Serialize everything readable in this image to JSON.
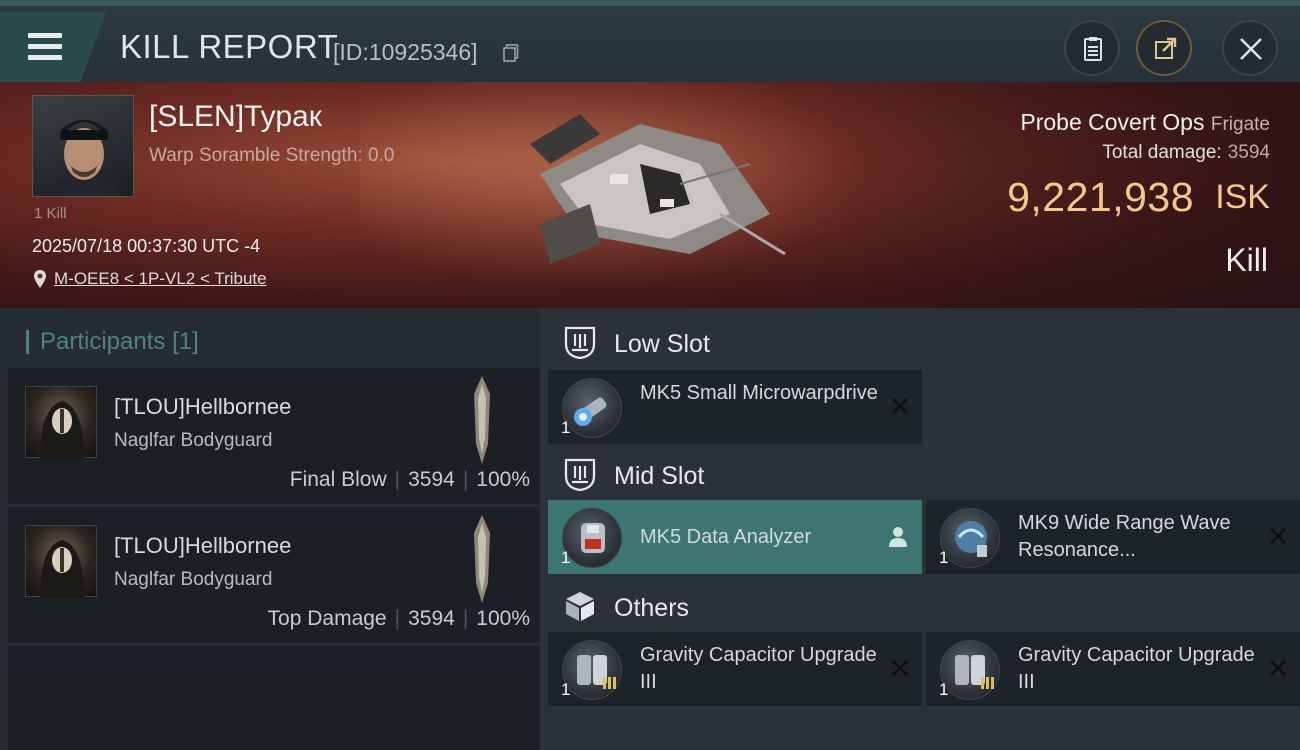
{
  "header": {
    "title": "KILL REPORT",
    "report_id": "[ID:10925346]"
  },
  "victim": {
    "name": "[SLEN]Турак",
    "warp_scramble": "Warp Soramble Strength: 0.0",
    "kills": "1 Kill",
    "datetime": "2025/07/18 00:37:30 UTC -4",
    "location": "M-OEE8 < 1P-VL2 < Tribute",
    "ship_name": "Probe Covert Ops",
    "ship_class": "Frigate",
    "total_damage_label": "Total damage:",
    "total_damage": "3594",
    "isk_value": "9,221,938",
    "isk_unit": "ISK",
    "result": "Kill"
  },
  "participants": {
    "title": "Participants",
    "count": "[1]",
    "rows": [
      {
        "name": "[TLOU]Hellbornee",
        "ship": "Naglfar Bodyguard",
        "tag": "Final Blow",
        "damage": "3594",
        "percent": "100%"
      },
      {
        "name": "[TLOU]Hellbornee",
        "ship": "Naglfar Bodyguard",
        "tag": "Top Damage",
        "damage": "3594",
        "percent": "100%"
      }
    ]
  },
  "fitting": {
    "low_slot": {
      "label": "Low Slot",
      "modules": [
        {
          "name": "MK5 Small Microwarpdrive",
          "qty": "1"
        }
      ]
    },
    "mid_slot": {
      "label": "Mid Slot",
      "modules": [
        {
          "name": "MK5 Data Analyzer",
          "qty": "1"
        },
        {
          "name": "MK9 Wide Range Wave Resonance...",
          "qty": "1"
        }
      ]
    },
    "others": {
      "label": "Others",
      "modules": [
        {
          "name": "Gravity Capacitor Upgrade III",
          "qty": "1"
        },
        {
          "name": "Gravity Capacitor Upgrade III",
          "qty": "1"
        }
      ]
    }
  },
  "colors": {
    "accent_teal": "#3d7572",
    "isk_gold": "#f3c98a",
    "participants_title": "#4d8286"
  },
  "icons": [
    "menu-icon",
    "copy-icon",
    "clipboard-icon",
    "share-icon",
    "close-icon",
    "location-pin-icon",
    "low-slot-icon",
    "mid-slot-icon",
    "others-box-icon",
    "remove-icon",
    "pilot-icon"
  ]
}
